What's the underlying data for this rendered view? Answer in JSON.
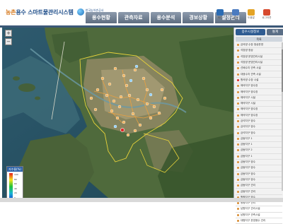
{
  "header": {
    "logo_accent": "농촌",
    "logo_text": "용수 스마트물관리시스템",
    "logo_sub_line1": "한국농어촌공사",
    "logo_sub_line2": "농업기반지원시스템",
    "menu": [
      {
        "label": "용수현황"
      },
      {
        "label": "관측자료"
      },
      {
        "label": "용수분석"
      },
      {
        "label": "경보상황"
      },
      {
        "label": "설정관리"
      }
    ],
    "icons": [
      {
        "name": "home-icon",
        "color": "#2b6cb4",
        "caption": "메인"
      },
      {
        "name": "user-icon",
        "color": "#4b7bc0",
        "caption": "회원"
      },
      {
        "name": "help-icon",
        "color": "#e3a326",
        "caption": "도움말"
      },
      {
        "name": "logout-icon",
        "color": "#d64a2e",
        "caption": "로그아웃"
      }
    ]
  },
  "legend": {
    "title": "저수율(%)",
    "ticks": [
      "100",
      "80",
      "60",
      "40",
      "20",
      "0"
    ]
  },
  "panel": {
    "tab_primary": "용수시설정보",
    "tab_secondary": "통계",
    "list_header": "목록",
    "items": [
      {
        "label": "금곡양 수장 정상운영",
        "alert": false
      },
      {
        "label": "석장양 정상",
        "alert": false
      },
      {
        "label": "석장양 운영관리시설",
        "alert": false
      },
      {
        "label": "석장양 운영관리시설",
        "alert": false
      },
      {
        "label": "선배수지 관측 시설",
        "alert": false
      },
      {
        "label": "대광수지 관측 시설",
        "alert": false
      },
      {
        "label": "원곡양 수장 시설",
        "alert": true
      },
      {
        "label": "매곡지구 양수장",
        "alert": false
      },
      {
        "label": "매곡지구 양수장",
        "alert": false
      },
      {
        "label": "매곡지구 시설",
        "alert": false
      },
      {
        "label": "매곡지구 시설",
        "alert": false
      },
      {
        "label": "매곡지구 양수장",
        "alert": false
      },
      {
        "label": "매곡지구 양수장",
        "alert": false
      },
      {
        "label": "금석지구 양수",
        "alert": false
      },
      {
        "label": "금석지구 양수",
        "alert": false
      },
      {
        "label": "금석지구 양수",
        "alert": false
      },
      {
        "label": "금동지구 1",
        "alert": false
      },
      {
        "label": "금동지구 1",
        "alert": false
      },
      {
        "label": "금동지구 2",
        "alert": false
      },
      {
        "label": "금동지구 1",
        "alert": false
      },
      {
        "label": "금동지구 양수",
        "alert": false
      },
      {
        "label": "금동지구 양수",
        "alert": false
      },
      {
        "label": "금동지구 양수",
        "alert": false
      },
      {
        "label": "금동지구 양수",
        "alert": false
      },
      {
        "label": "금동지구 관리",
        "alert": false
      },
      {
        "label": "금동지구 관리",
        "alert": false
      },
      {
        "label": "원평지구 양수",
        "alert": false
      },
      {
        "label": "원평지구 관리",
        "alert": false
      },
      {
        "label": "남원지구 관리시설",
        "alert": false
      },
      {
        "label": "남원지구 관측시설",
        "alert": false
      },
      {
        "label": "대평지구 운영용수 관리",
        "alert": false
      }
    ]
  }
}
